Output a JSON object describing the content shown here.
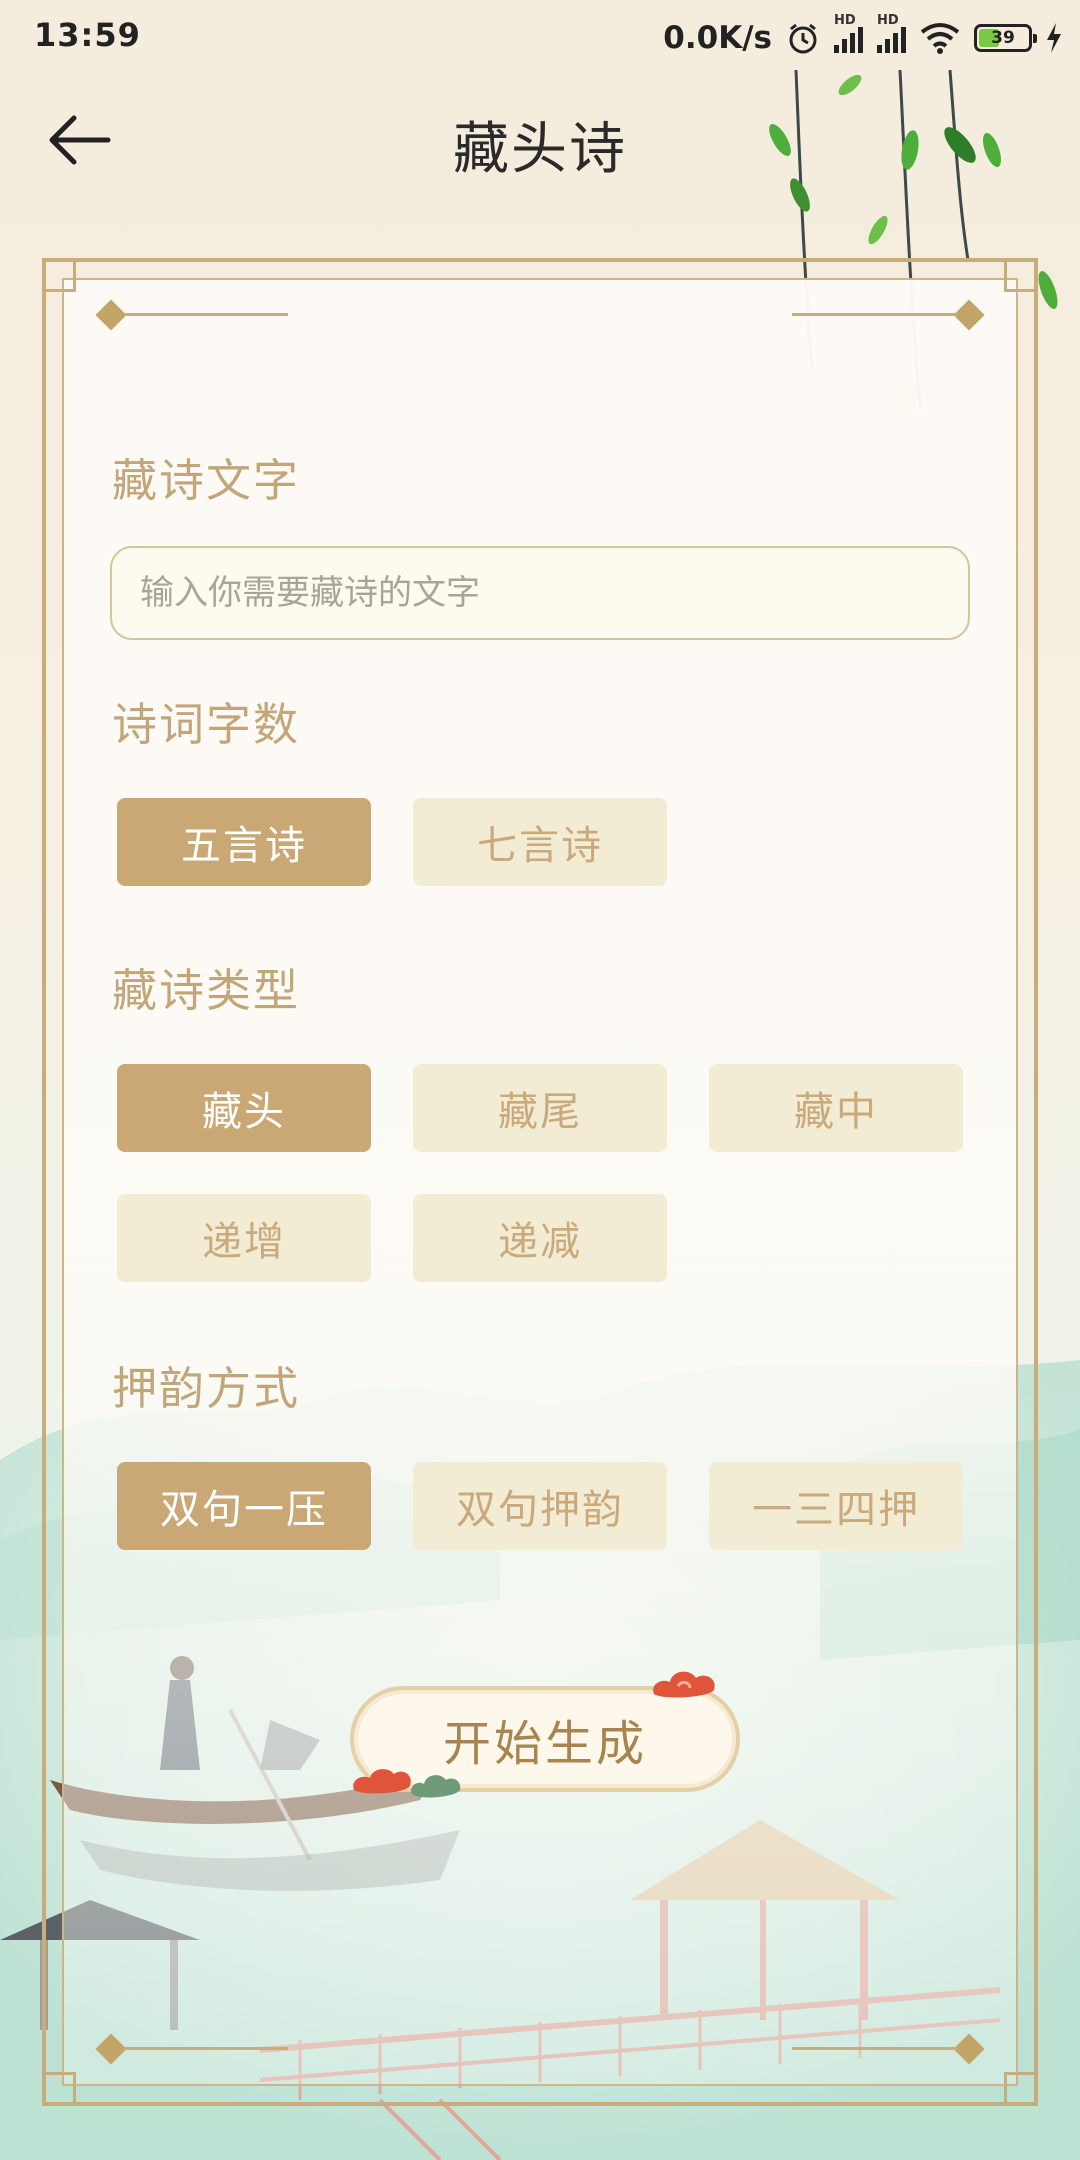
{
  "status_bar": {
    "time": "13:59",
    "speed": "0.0K/s",
    "hd_label": "HD",
    "battery": "39",
    "battery_level": 0.39
  },
  "header": {
    "title": "藏头诗"
  },
  "form": {
    "text_label": "藏诗文字",
    "text_placeholder": "输入你需要藏诗的文字",
    "length_label": "诗词字数",
    "length_options": [
      "五言诗",
      "七言诗"
    ],
    "type_label": "藏诗类型",
    "type_options": [
      "藏头",
      "藏尾",
      "藏中",
      "递增",
      "递减"
    ],
    "rhyme_label": "押韵方式",
    "rhyme_options": [
      "双句一压",
      "双句押韵",
      "一三四押"
    ],
    "start_label": "开始生成"
  },
  "colors": {
    "accent": "#c9a876",
    "label": "#c3a57a",
    "option_off_bg": "#f2ecd5",
    "frame": "#c9ac7b"
  }
}
